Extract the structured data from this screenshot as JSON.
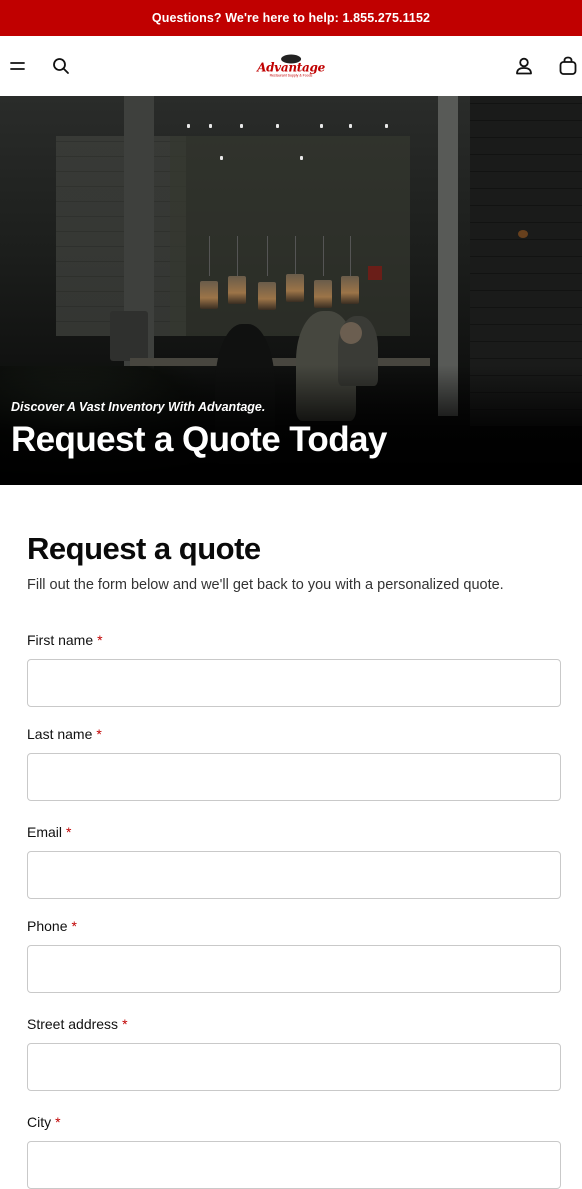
{
  "announcement": {
    "text": "Questions? We're here to help: 1.855.275.1152"
  },
  "header": {
    "menu_icon": "hamburger-icon",
    "search_icon": "search-icon",
    "logo_text": "Advantage",
    "logo_tagline": "Restaurant Supply & Foods",
    "account_icon": "user-icon",
    "cart_icon": "shopping-bag-icon"
  },
  "hero": {
    "eyebrow": "Discover A Vast Inventory With Advantage.",
    "headline": "Request a Quote Today"
  },
  "form": {
    "title": "Request a quote",
    "subtitle": "Fill out the form below and we'll get back to you with a personalized quote.",
    "required_marker": "*",
    "fields": [
      {
        "label": "First name",
        "value": ""
      },
      {
        "label": "Last name",
        "value": ""
      },
      {
        "label": "Email",
        "value": ""
      },
      {
        "label": "Phone",
        "value": ""
      },
      {
        "label": "Street address",
        "value": ""
      },
      {
        "label": "City",
        "value": ""
      }
    ]
  },
  "colors": {
    "brand_red": "#c00000",
    "hero_bg": "#0b0b0b"
  }
}
